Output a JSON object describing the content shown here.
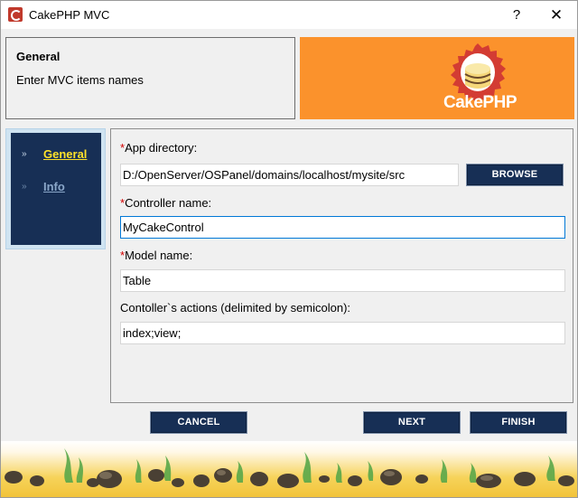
{
  "window": {
    "title": "CakePHP MVC",
    "help_glyph": "?",
    "close_glyph": "✕",
    "icon": "cakephp-app-icon"
  },
  "header": {
    "title": "General",
    "subtitle": "Enter MVC items names",
    "banner_color": "#fb922c",
    "logo_text_cake": "Cake",
    "logo_text_php": "PHP"
  },
  "nav": {
    "items": [
      {
        "label": "General",
        "active": true,
        "arrow": "»"
      },
      {
        "label": "Info",
        "active": false,
        "arrow": "»"
      }
    ]
  },
  "form": {
    "app_dir": {
      "required_mark": "*",
      "label": "App directory:",
      "value": "D:/OpenServer/OSPanel/domains/localhost/mysite/src"
    },
    "browse_label": "BROWSE",
    "controller": {
      "required_mark": "*",
      "label": "Controller name:",
      "value": "MyCakeControl"
    },
    "model": {
      "required_mark": "*",
      "label": "Model name:",
      "value": "Table"
    },
    "actions": {
      "label": "Contoller`s actions (delimited by semicolon):",
      "value": "index;view;"
    }
  },
  "buttons": {
    "cancel": "CANCEL",
    "next": "NEXT",
    "finish": "FINISH"
  },
  "colors": {
    "accent_navy": "#172f55",
    "active_link": "#ffe12a",
    "required": "#d40000"
  }
}
